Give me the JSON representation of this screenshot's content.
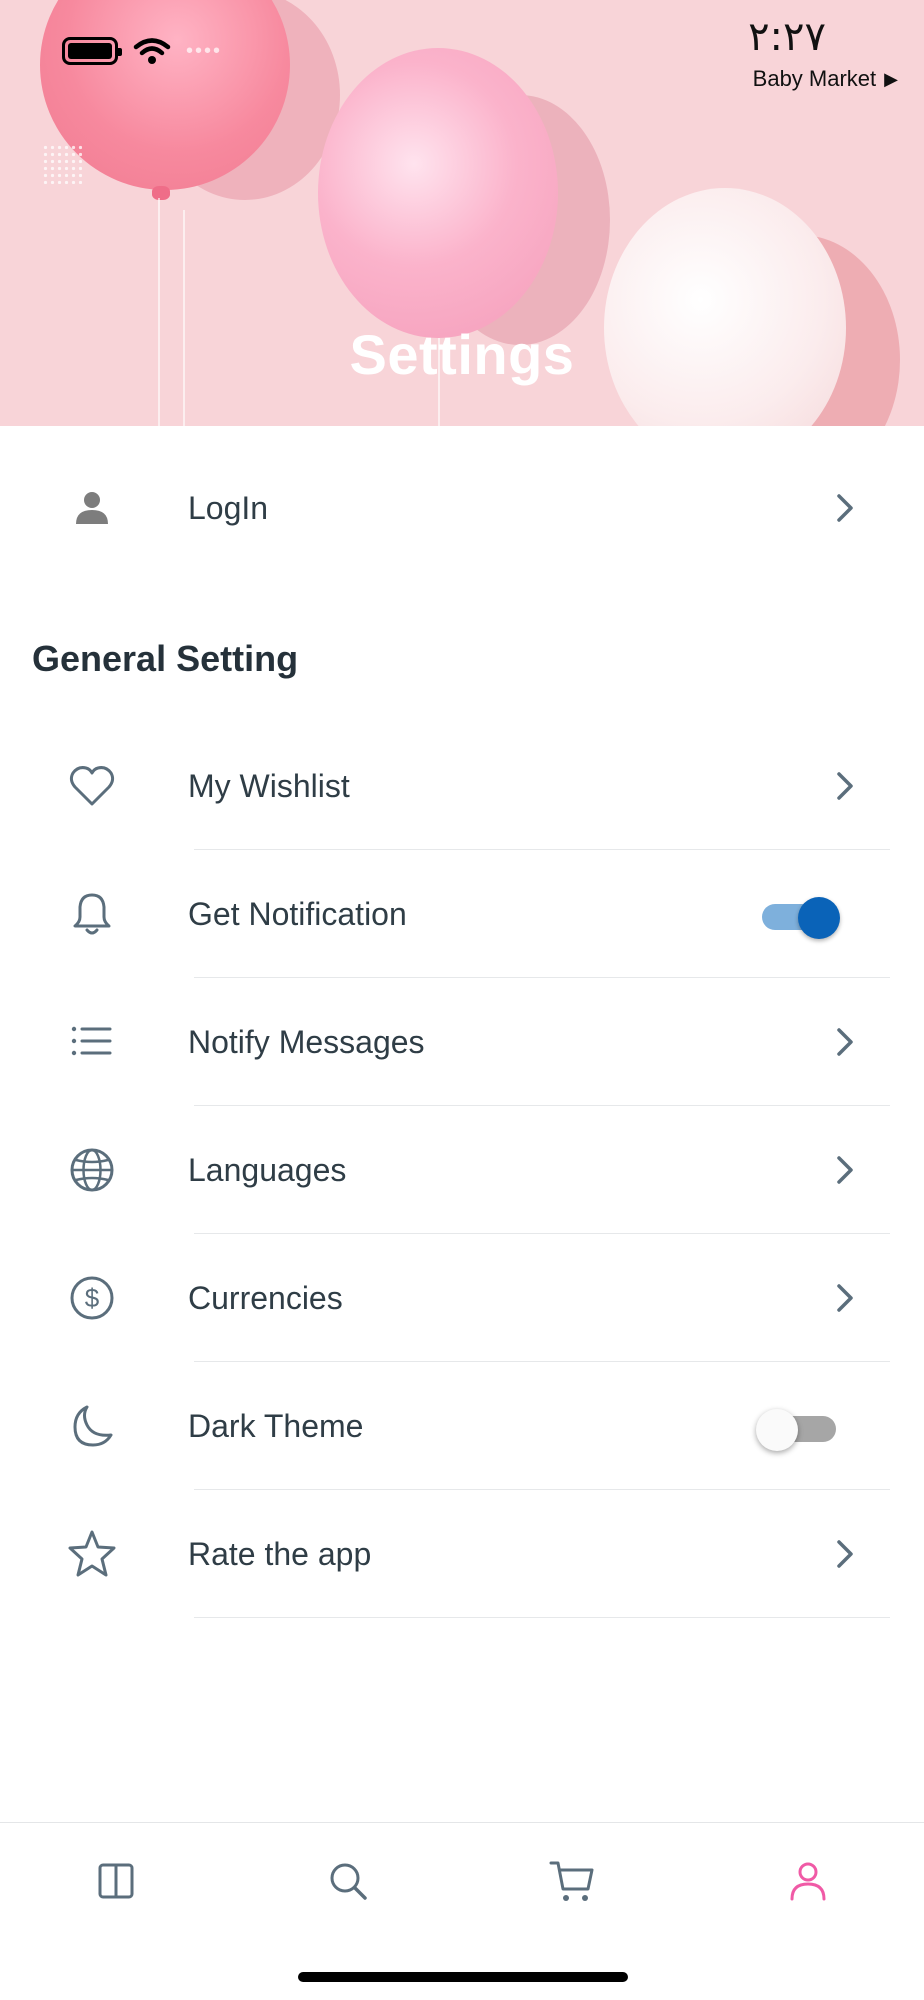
{
  "status_bar": {
    "time": "٢:٢٧",
    "back_app": "Baby Market",
    "back_icon": "play-triangle-icon"
  },
  "header": {
    "title": "Settings",
    "background_color": "#f8d4d8"
  },
  "login": {
    "label": "LogIn",
    "icon": "person-icon"
  },
  "general": {
    "title": "General Setting",
    "items": [
      {
        "label": "My Wishlist",
        "icon": "heart-icon",
        "control": "chevron"
      },
      {
        "label": "Get Notification",
        "icon": "bell-icon",
        "control": "toggle",
        "toggle_on": true
      },
      {
        "label": "Notify Messages",
        "icon": "list-icon",
        "control": "chevron"
      },
      {
        "label": "Languages",
        "icon": "globe-icon",
        "control": "chevron"
      },
      {
        "label": "Currencies",
        "icon": "dollar-circle-icon",
        "control": "chevron"
      },
      {
        "label": "Dark Theme",
        "icon": "moon-icon",
        "control": "toggle",
        "toggle_on": false
      },
      {
        "label": "Rate the app",
        "icon": "star-icon",
        "control": "chevron"
      }
    ]
  },
  "bottom_nav": {
    "items": [
      {
        "icon": "home-columns-icon",
        "active": false
      },
      {
        "icon": "search-icon",
        "active": false
      },
      {
        "icon": "cart-icon",
        "active": false
      },
      {
        "icon": "profile-icon",
        "active": true
      }
    ],
    "active_color": "#f05aa6",
    "inactive_color": "#5b6e7c"
  },
  "colors": {
    "text": "#2f3d46",
    "icon": "#5b6e7c",
    "toggle_on": "#0a63b8"
  }
}
